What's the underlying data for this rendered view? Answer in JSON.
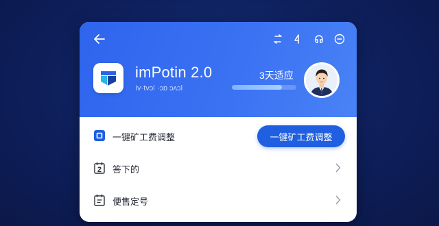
{
  "header": {
    "title": "imPotin 2.0",
    "subtitle": "Iv·tvɔl ·ɔɒ ɔʌɔl",
    "progress": {
      "label": "3天适应",
      "fraction": 0.78
    },
    "icons": [
      "back-arrow-icon",
      "swap-icon",
      "share-icon",
      "headset-icon",
      "menu-circle-icon"
    ]
  },
  "rows": [
    {
      "label": "一键矿工费调整",
      "icon": "square-box-icon",
      "button_label": "一键矿工费调整"
    },
    {
      "label": "答下的",
      "icon": "calendar-2-icon"
    },
    {
      "label": "便售定号",
      "icon": "calendar-list-icon"
    }
  ],
  "colors": {
    "header_blue": "#3b73f3",
    "button_blue": "#1f5fe0",
    "background": "#0e1f5c"
  }
}
